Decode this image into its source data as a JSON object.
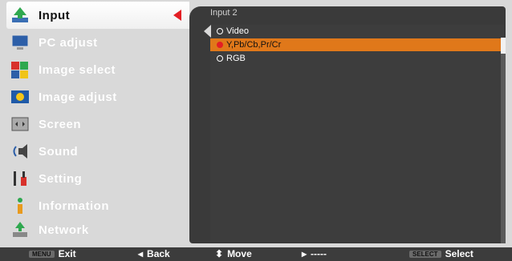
{
  "menu": {
    "items": [
      {
        "label": "Input",
        "icon": "input-icon"
      },
      {
        "label": "PC adjust",
        "icon": "monitor-icon"
      },
      {
        "label": "Image select",
        "icon": "image-select-icon"
      },
      {
        "label": "Image adjust",
        "icon": "image-adjust-icon"
      },
      {
        "label": "Screen",
        "icon": "screen-icon"
      },
      {
        "label": "Sound",
        "icon": "sound-icon"
      },
      {
        "label": "Setting",
        "icon": "setting-icon"
      },
      {
        "label": "Information",
        "icon": "information-icon"
      },
      {
        "label": "Network",
        "icon": "network-icon"
      }
    ],
    "selected_index": 0
  },
  "panel": {
    "title": "Input 2",
    "options": [
      {
        "label": "Video",
        "selected": false
      },
      {
        "label": "Y,Pb/Cb,Pr/Cr",
        "selected": true
      },
      {
        "label": "RGB",
        "selected": false
      }
    ]
  },
  "bottom_bar": {
    "exit_tag": "MENU",
    "exit_label": "Exit",
    "back_label": "Back",
    "move_label": "Move",
    "next_label": "-----",
    "select_tag": "SELECT",
    "select_label": "Select"
  },
  "colors": {
    "highlight": "#e0781a",
    "panel_bg": "#3a3a3a",
    "menu_bg": "#d9d9d9",
    "accent_red": "#e31e24"
  }
}
